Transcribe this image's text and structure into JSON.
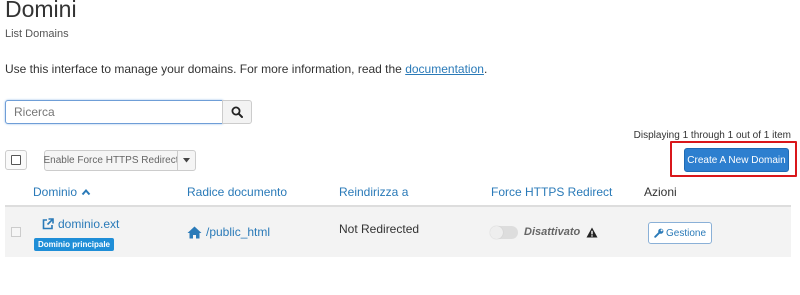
{
  "page": {
    "title": "Domini",
    "subtitle": "List Domains",
    "intro_text": "Use this interface to manage your domains. For more information, read the ",
    "intro_link": "documentation",
    "intro_end": "."
  },
  "search": {
    "placeholder": "Ricerca",
    "value": ""
  },
  "toolbar": {
    "display_count": "Displaying 1 through 1 out of 1 item",
    "bulk_action_label": "Enable Force HTTPS Redirect",
    "create_label": "Create A New Domain",
    "highlight_color": "#d9171b",
    "primary_color": "#2d7fcf"
  },
  "table": {
    "headers": {
      "domain": "Dominio",
      "docroot": "Radice documento",
      "redirect": "Reindirizza a",
      "https": "Force HTTPS Redirect",
      "actions": "Azioni"
    },
    "sort": "ascending",
    "rows": [
      {
        "domain": "dominio.ext",
        "badge": "Dominio principale",
        "docroot": "/public_html",
        "redirect": "Not Redirected",
        "https_enabled": false,
        "https_status": "Disattivato",
        "action": "Gestione"
      }
    ]
  },
  "icons": {
    "search": "search-icon",
    "sort": "sort-asc-icon",
    "external": "external-link-icon",
    "home": "home-icon",
    "warning": "warning-icon",
    "wrench": "wrench-icon",
    "caret": "chevron-down-icon"
  }
}
